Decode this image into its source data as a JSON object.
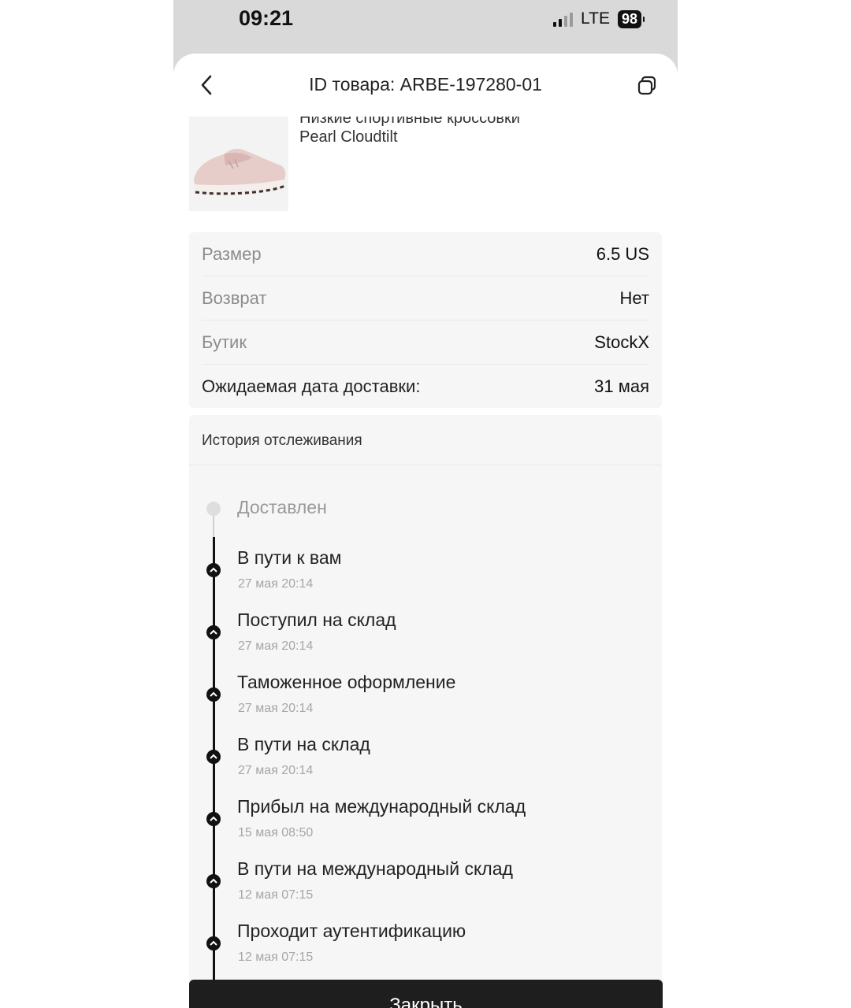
{
  "status_bar": {
    "time": "09:21",
    "network": "LTE",
    "battery": "98"
  },
  "header": {
    "title": "ID товара: ARBE-197280-01",
    "back_icon": "chevron-left-icon",
    "copy_icon": "copy-icon"
  },
  "product": {
    "name": "Низкие спортивные кроссовки Pearl Cloudtilt"
  },
  "details": [
    {
      "label": "Размер",
      "value": "6.5 US"
    },
    {
      "label": "Возврат",
      "value": "Нет"
    },
    {
      "label": "Бутик",
      "value": "StockX"
    },
    {
      "label": "Ожидаемая дата доставки:",
      "value": "31 мая"
    }
  ],
  "tracking": {
    "title": "История отслеживания",
    "steps": [
      {
        "title": "Доставлен",
        "date": ""
      },
      {
        "title": "В пути к вам",
        "date": "27 мая 20:14"
      },
      {
        "title": "Поступил на склад",
        "date": "27 мая 20:14"
      },
      {
        "title": "Таможенное оформление",
        "date": "27 мая 20:14"
      },
      {
        "title": "В пути на склад",
        "date": "27 мая 20:14"
      },
      {
        "title": "Прибыл на международный склад",
        "date": "15 мая 08:50"
      },
      {
        "title": "В пути на международный склад",
        "date": "12 мая 07:15"
      },
      {
        "title": "Проходит аутентификацию",
        "date": "12 мая 07:15"
      }
    ]
  },
  "footer": {
    "close_label": "Закрыть"
  },
  "colors": {
    "accent": "#1e1e1e",
    "background": "#d9d9d9",
    "panel": "#f6f6f6"
  }
}
